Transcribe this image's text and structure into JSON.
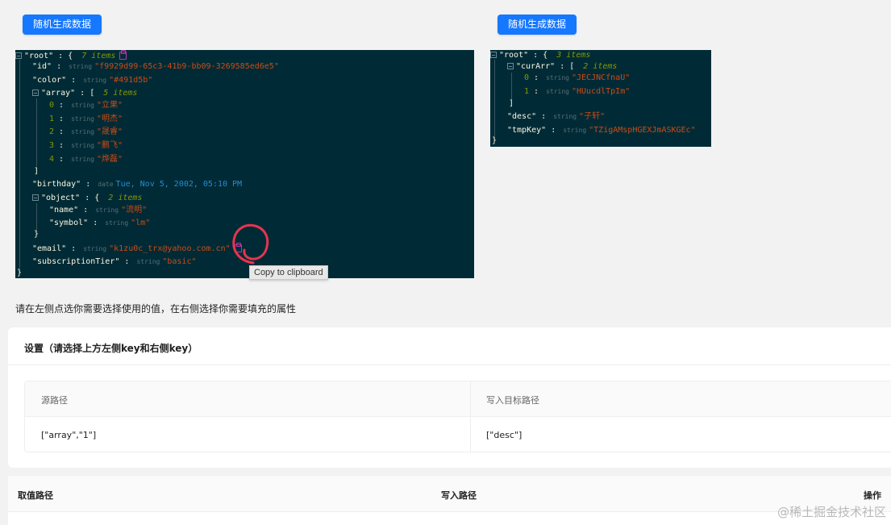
{
  "buttons": {
    "left_generate": "随机生成数据",
    "right_generate": "随机生成数据"
  },
  "left_json": {
    "root_key": "\"root\"",
    "root_count": "7 items",
    "id_key": "\"id\"",
    "id_type": "string",
    "id_value": "\"f9929d99-65c3-41b9-bb09-3269585ed6e5\"",
    "color_key": "\"color\"",
    "color_type": "string",
    "color_value": "\"#491d5b\"",
    "array_key": "\"array\"",
    "array_count": "5 items",
    "array_items": [
      {
        "index": "0",
        "type": "string",
        "value": "\"立果\""
      },
      {
        "index": "1",
        "type": "string",
        "value": "\"明杰\""
      },
      {
        "index": "2",
        "type": "string",
        "value": "\"晟睿\""
      },
      {
        "index": "3",
        "type": "string",
        "value": "\"鹏飞\""
      },
      {
        "index": "4",
        "type": "string",
        "value": "\"烨磊\""
      }
    ],
    "birthday_key": "\"birthday\"",
    "birthday_type": "date",
    "birthday_value": "Tue, Nov 5, 2002, 05:10 PM",
    "object_key": "\"object\"",
    "object_count": "2 items",
    "name_key": "\"name\"",
    "name_type": "string",
    "name_value": "\"流明\"",
    "symbol_key": "\"symbol\"",
    "symbol_type": "string",
    "symbol_value": "\"lm\"",
    "email_key": "\"email\"",
    "email_type": "string",
    "email_value": "\"k1zu0c_trx@yahoo.com.cn\"",
    "tier_key": "\"subscriptionTier\"",
    "tier_type": "string",
    "tier_value": "\"basic\""
  },
  "right_json": {
    "root_key": "\"root\"",
    "root_count": "3 items",
    "curarr_key": "\"curArr\"",
    "curarr_count": "2 items",
    "curarr_items": [
      {
        "index": "0",
        "type": "string",
        "value": "\"JECJNCfnaU\""
      },
      {
        "index": "1",
        "type": "string",
        "value": "\"HUucdlTpIm\""
      }
    ],
    "desc_key": "\"desc\"",
    "desc_type": "string",
    "desc_value": "\"子轩\"",
    "tmpkey_key": "\"tmpKey\"",
    "tmpkey_type": "string",
    "tmpkey_value": "\"TZigAMspHGEXJmASKGEc\""
  },
  "tooltip": "Copy to clipboard",
  "hint": "请在左侧点选你需要选择使用的值，在右侧选择你需要填充的属性",
  "settings": {
    "title": "设置（请选择上方左侧key和右侧key）",
    "col_source": "源路径",
    "col_target": "写入目标路径",
    "source_value": "[\"array\",\"1\"]",
    "target_value": "[\"desc\"]"
  },
  "bottom_table": {
    "col_take": "取值路径",
    "col_write": "写入路径",
    "col_action": "操作"
  },
  "watermark": "@稀土掘金技术社区",
  "colors": {
    "primary": "#1677ff",
    "json_bg": "#002b36",
    "string": "#cb4b16",
    "date": "#268bd2",
    "count": "#859900",
    "annotation": "#e8344e"
  }
}
